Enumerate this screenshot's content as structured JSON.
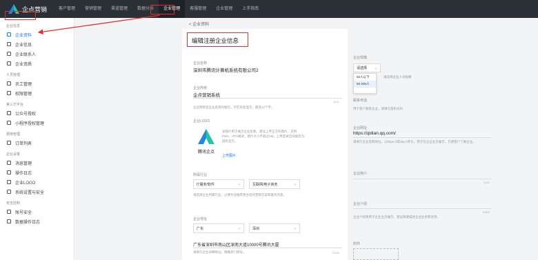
{
  "topbar": {
    "brand": "企点营销",
    "nav": [
      "客户管理",
      "营销管理",
      "渠道管理",
      "数据分析",
      "企业管理",
      "客服管理",
      "企业管理",
      "上手指南"
    ],
    "active_index": 4
  },
  "sidebar": {
    "groups": [
      {
        "title": "企业信息",
        "items": [
          "企业资料",
          "企业信息",
          "企业联系人",
          "企业资质"
        ]
      },
      {
        "title": "人员管理",
        "items": [
          "员工管理",
          "权限管理"
        ]
      },
      {
        "title": "第三方平台",
        "items": [
          "公众号授权",
          "小程序授权管理"
        ]
      },
      {
        "title": "费用管理",
        "items": [
          "订单列表"
        ]
      },
      {
        "title": "企业设置",
        "items": [
          "消息管理",
          "操作日志",
          "企业LOGO",
          "系统设置与安全"
        ]
      },
      {
        "title": "安全控制",
        "items": [
          "账号安全",
          "数据操作日志"
        ]
      }
    ],
    "active": "企业资料"
  },
  "form": {
    "back": "< 企业资料",
    "title": "编辑注册企业信息",
    "name_label": "企业名称",
    "name_value": "深圳市腾讯计算机系统有限公司2",
    "short_label": "企业简称",
    "short_value": "企点营销系统",
    "short_hint": "企业简称是企业名称的缩写，可在各处显示，最多12个字。",
    "short_count": "6/12",
    "logo_label": "企业LOGO",
    "logo_text": "腾讯企点",
    "logo_hint": "该图片用于展示企业形象，建议上传正方形图片，支持PNG、JPG格式，图片大小不超过2M，上传后将自动裁剪为圆形显示。",
    "logo_link": "上传图片",
    "industry_label": "所属行业",
    "industry_1": "IT服务/软件",
    "industry_2": "互联网/电子商务",
    "industry_hint": "请选择企业所属行业，以便为您推荐更合适的营销方案和服务内容。",
    "region_label": "企业地址",
    "region_1": "广东",
    "region_2": "深圳",
    "address_value": "广东省深圳市南山区深南大道10000号腾讯大厦",
    "address_hint": "请填写企业详细地址，精确到门牌号。",
    "address_count": "22/64"
  },
  "right": {
    "scale_label": "企业规模",
    "scale_value": "请选择",
    "scale_options": [
      "请选择",
      "50人以下",
      "50-200人"
    ],
    "scale_hint": "请选择企业人员规模",
    "phone_label": "联系电话",
    "phone_hint": "用于客户联系企业，请填写座机号码",
    "site_label": "企业网址",
    "site_value": "https://qidian.qq.com/",
    "site_hint": "请填写企业官网地址，以https://或http://开头，用于在企业主页展示，方便客户了解企业。",
    "intro_label": "企业简介",
    "intro_count": "0/40",
    "desc_label": "企业介绍",
    "desc_count": "0/400",
    "desc_hint": "企业介绍将用于企业主页展示，建议简要描述企业业务和优势。",
    "attach_label": "附件"
  }
}
